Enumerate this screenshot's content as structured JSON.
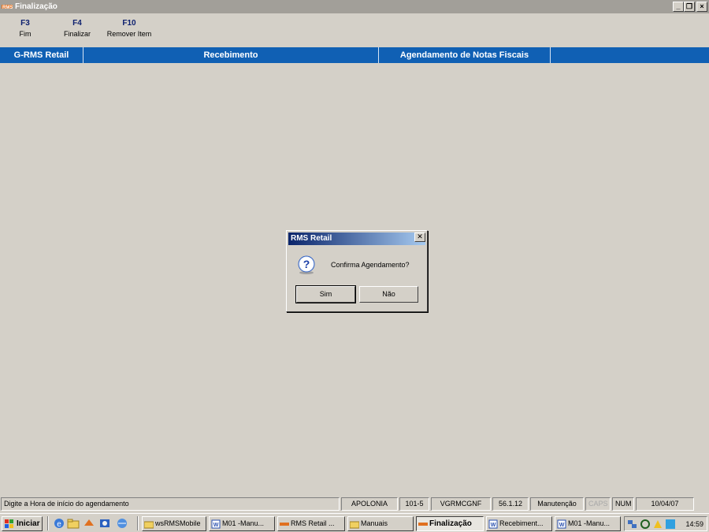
{
  "window": {
    "title": "Finalização"
  },
  "fkeys": [
    {
      "key": "F3",
      "label": "Fim"
    },
    {
      "key": "F4",
      "label": "Finalizar"
    },
    {
      "key": "F10",
      "label": "Remover Item"
    }
  ],
  "header": {
    "module": "G-RMS Retail",
    "section": "Recebimento",
    "screen": "Agendamento de Notas Fiscais"
  },
  "dialog": {
    "title": "RMS Retail",
    "message": "Confirma Agendamento?",
    "yes_label": "Sim",
    "no_label": "Não",
    "icon": "question-icon"
  },
  "status_bar": {
    "message": "Digite a Hora de início do agendamento",
    "server": "APOLONIA",
    "store": "101-5",
    "program": "VGRMCGNF",
    "version": "56.1.12",
    "mode": "Manutenção",
    "caps": "CAPS",
    "num": "NUM",
    "date": "10/04/07"
  },
  "taskbar": {
    "start_label": "Iniciar",
    "tasks": [
      {
        "label": "wsRMSMobile",
        "icon": "folder-icon"
      },
      {
        "label": "M01 -Manu...",
        "icon": "word-doc-icon"
      },
      {
        "label": "RMS Retail ...",
        "icon": "rms-icon"
      },
      {
        "label": "Manuais",
        "icon": "folder-icon"
      },
      {
        "label": "Finalização",
        "icon": "rms-icon",
        "active": true
      },
      {
        "label": "Recebiment...",
        "icon": "word-doc-icon"
      },
      {
        "label": "M01 -Manu...",
        "icon": "word-doc-icon"
      }
    ],
    "clock": "14:59"
  },
  "colors": {
    "header_band": "#1060b4",
    "fkey_text": "#0c1f6e",
    "titlebar_inactive": "#a29f99",
    "dialog_title": "#0a246a"
  }
}
